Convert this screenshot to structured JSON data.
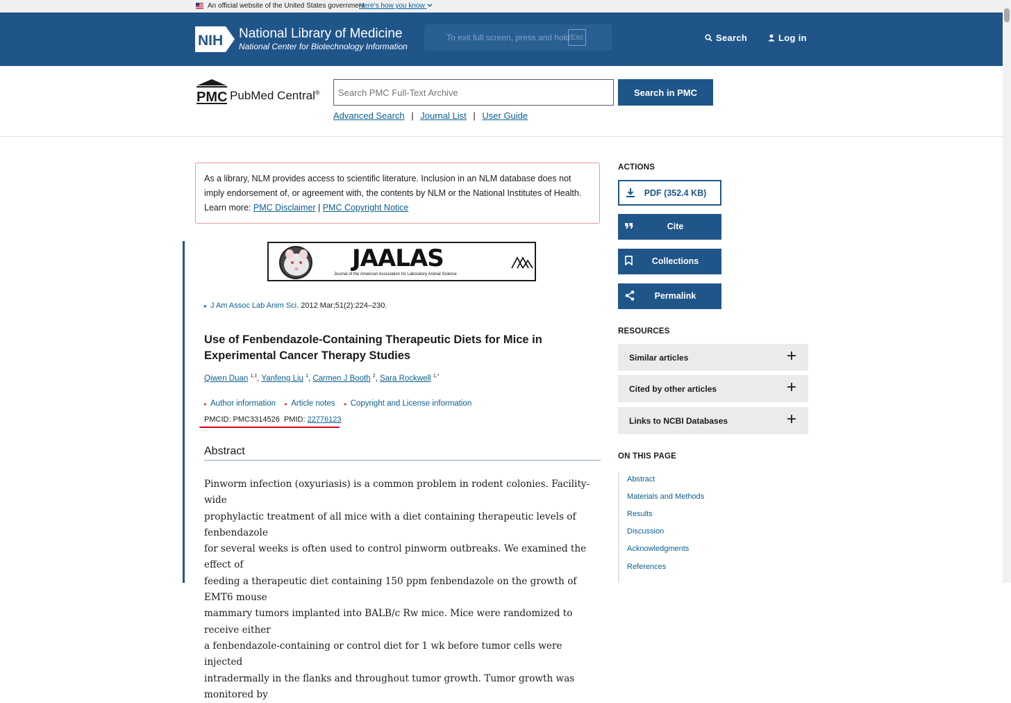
{
  "gov_banner": {
    "text": "An official website of the United States government",
    "how_link": "Here's how you know"
  },
  "nih": {
    "logo_text": "NIH",
    "title": "National Library of Medicine",
    "subtitle": "National Center for Biotechnology Information",
    "search_label": "Search",
    "login_label": "Log in"
  },
  "fullscreen_notice": {
    "text": "To exit full screen, press and hold",
    "key": "Esc"
  },
  "pmc": {
    "logo_text": "PMC",
    "name": "PubMed Central",
    "reg": "®",
    "search_placeholder": "Search PMC Full-Text Archive",
    "search_button": "Search in PMC",
    "links": [
      "Advanced Search",
      "Journal List",
      "User Guide"
    ],
    "separator": "|"
  },
  "disclaimer": {
    "line1": "As a library, NLM provides access to scientific literature. Inclusion in an NLM database does not",
    "line2": "imply endorsement of, or agreement with, the contents by NLM or the National Institutes of Health.",
    "learn_more": "Learn more:",
    "link1": "PMC Disclaimer",
    "sep": "|",
    "link2": "PMC Copyright Notice"
  },
  "journal_banner": {
    "title": "JAALAS",
    "subtitle": "Journal of the American Association for Laboratory Animal Science"
  },
  "article": {
    "journal": "J Am Assoc Lab Anim Sci",
    "citation": ". 2012 Mar;51(2):224–230.",
    "title": "Use of Fenbendazole-Containing Therapeutic Diets for Mice in Experimental Cancer Therapy Studies",
    "authors": [
      {
        "name": "Qiwen Duan",
        "sup": "1,‡"
      },
      {
        "name": "Yanfeng Liu",
        "sup": "1"
      },
      {
        "name": "Carmen J Booth",
        "sup": "2"
      },
      {
        "name": "Sara Rockwell",
        "sup": "1,*"
      }
    ],
    "meta_links": [
      "Author information",
      "Article notes",
      "Copyright and License information"
    ],
    "pmcid_label": "PMCID: PMC3314526",
    "pmid_label": "PMID:",
    "pmid": "22776123",
    "abstract_heading": "Abstract",
    "abstract_lines": [
      "Pinworm infection (oxyuriasis) is a common problem in rodent colonies. Facility-wide",
      "prophylactic treatment of all mice with a diet containing therapeutic levels of fenbendazole",
      "for several weeks is often used to control pinworm outbreaks. We examined the effect of",
      "feeding a therapeutic diet containing 150 ppm fenbendazole on the growth of EMT6 mouse",
      "mammary tumors implanted into BALB/c Rw mice. Mice were randomized to receive either",
      "a fenbendazole-containing or control diet for 1 wk before tumor cells were injected",
      "intradermally in the flanks and throughout tumor growth. Tumor growth was monitored by"
    ]
  },
  "sidebar": {
    "actions_heading": "ACTIONS",
    "actions": [
      {
        "label": "PDF (352.4 KB)",
        "icon": "download-icon"
      },
      {
        "label": "Cite",
        "icon": "quote-icon"
      },
      {
        "label": "Collections",
        "icon": "bookmark-icon"
      },
      {
        "label": "Permalink",
        "icon": "share-icon"
      }
    ],
    "resources_heading": "RESOURCES",
    "resources": [
      "Similar articles",
      "Cited by other articles",
      "Links to NCBI Databases"
    ],
    "on_this_page_heading": "ON THIS PAGE",
    "on_this_page": [
      "Abstract",
      "Materials and Methods",
      "Results",
      "Discussion",
      "Acknowledgments",
      "References"
    ]
  },
  "colors": {
    "header_blue": "#20558a",
    "link": "#0b5e8e",
    "disclaimer_border": "#e39d9d",
    "highlight_red": "#d9001b"
  }
}
